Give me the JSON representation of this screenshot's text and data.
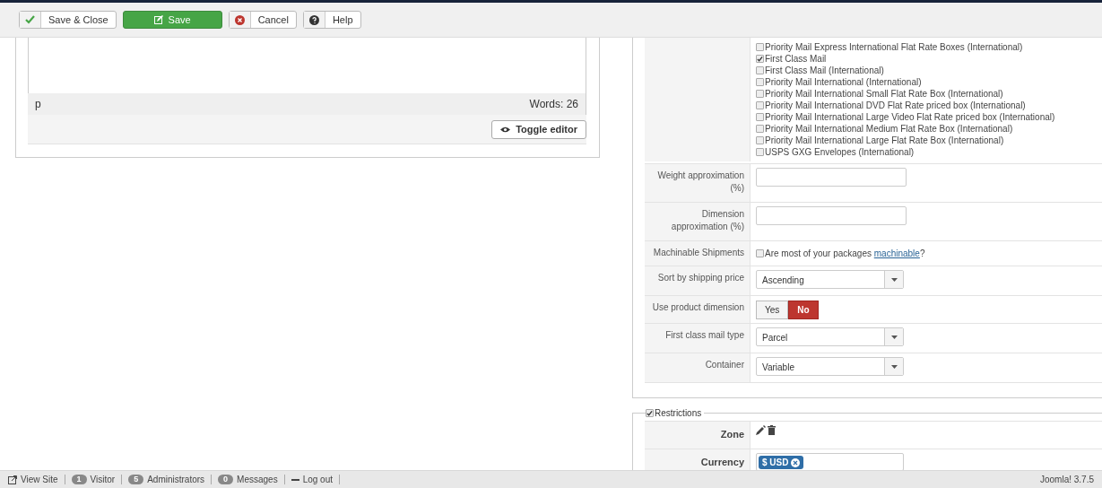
{
  "toolbar": [
    {
      "label": "Save & Close",
      "kind": "save-close"
    },
    {
      "label": "Save",
      "kind": "save"
    },
    {
      "label": "Cancel",
      "kind": "cancel"
    },
    {
      "label": "Help",
      "kind": "help"
    }
  ],
  "editor": {
    "path": "p",
    "word_count": "Words: 26",
    "toggle_label": "Toggle editor"
  },
  "services": [
    {
      "label": "Priority Mail Express International Flat Rate Boxes (International)",
      "checked": false
    },
    {
      "label": "First Class Mail",
      "checked": true
    },
    {
      "label": "First Class Mail (International)",
      "checked": false
    },
    {
      "label": "Priority Mail International (International)",
      "checked": false
    },
    {
      "label": "Priority Mail International Small Flat Rate Box (International)",
      "checked": false
    },
    {
      "label": "Priority Mail International DVD Flat Rate priced box (International)",
      "checked": false
    },
    {
      "label": "Priority Mail International Large Video Flat Rate priced box (International)",
      "checked": false
    },
    {
      "label": "Priority Mail International Medium Flat Rate Box (International)",
      "checked": false
    },
    {
      "label": "Priority Mail International Large Flat Rate Box (International)",
      "checked": false
    },
    {
      "label": "USPS GXG Envelopes (International)",
      "checked": false
    }
  ],
  "fields": [
    {
      "kind": "text",
      "label": "Weight approximation (%)"
    },
    {
      "kind": "text",
      "label": "Dimension approximation (%)"
    },
    {
      "kind": "check",
      "label": "Machinable Shipments",
      "text": "Are most of your packages ",
      "link": "machinable",
      "after": "?",
      "checked": false
    },
    {
      "kind": "select",
      "label": "Sort by shipping price",
      "value": "Ascending"
    },
    {
      "kind": "toggle",
      "label": "Use product dimension",
      "options": [
        {
          "label": "Yes",
          "selected": false
        },
        {
          "label": "No",
          "selected": true
        }
      ]
    },
    {
      "kind": "select",
      "label": "First class mail type",
      "value": "Parcel"
    },
    {
      "kind": "select",
      "label": "Container",
      "value": "Variable"
    }
  ],
  "restrictions": {
    "legend": "Restrictions",
    "checked": true,
    "rows": [
      {
        "kind": "actions",
        "label": "Zone"
      },
      {
        "kind": "tags",
        "label": "Currency",
        "tags": [
          "$ USD"
        ]
      }
    ]
  },
  "status_bar": {
    "items": [
      {
        "kind": "view",
        "label": "View Site"
      },
      {
        "kind": "count",
        "count": "1",
        "label": "Visitor"
      },
      {
        "kind": "count",
        "count": "5",
        "label": "Administrators"
      },
      {
        "kind": "count",
        "count": "0",
        "label": "Messages"
      },
      {
        "kind": "logout",
        "label": "Log out"
      }
    ],
    "version": "Joomla! 3.7.5"
  }
}
